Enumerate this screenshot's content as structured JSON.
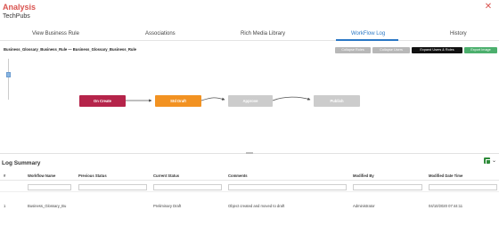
{
  "header": {
    "title": "Analysis",
    "subtitle": "TechPubs",
    "close_icon": "close-icon"
  },
  "tabs": [
    {
      "label": "View Business Rule",
      "active": false
    },
    {
      "label": "Associations",
      "active": false
    },
    {
      "label": "Rich Media Library",
      "active": false
    },
    {
      "label": "WorkFlow Log",
      "active": true
    },
    {
      "label": "History",
      "active": false
    }
  ],
  "breadcrumb": "Business_Glossary_Business_Rule — Business_Glossary_Business_Rule",
  "toolbar": {
    "collapse_roles": "Collapse Roles",
    "collapse_users": "Collapse Users",
    "expand_users_roles": "Expand Users & Roles",
    "export_image": "Export Image"
  },
  "workflow": {
    "nodes": [
      {
        "label": "On Create",
        "color": "#b5244a"
      },
      {
        "label": "Std Draft",
        "color": "#f29222"
      },
      {
        "label": "Approve",
        "color": "#cccccc"
      },
      {
        "label": "Publish",
        "color": "#cccccc"
      }
    ]
  },
  "log": {
    "title": "Log Summary",
    "export_icon": "excel-export-icon",
    "columns": [
      "#",
      "Workflow Name",
      "Previous Status",
      "Current Status",
      "Comments",
      "Modified By",
      "Modified Date Time"
    ],
    "rows": [
      {
        "num": "1",
        "workflow_name": "Business_Glossary_Bu",
        "previous_status": "",
        "current_status": "Preliminary Draft",
        "comments": "Object created and moved to draft",
        "modified_by": "Administrator",
        "modified_date": "04/10/2020 07:44:11"
      }
    ]
  },
  "colors": {
    "accent": "#2a77c5",
    "title_red": "#d9534f",
    "collapse_btn": "#b8b8b8",
    "expand_btn": "#111111",
    "export_btn": "#4caf6d"
  }
}
